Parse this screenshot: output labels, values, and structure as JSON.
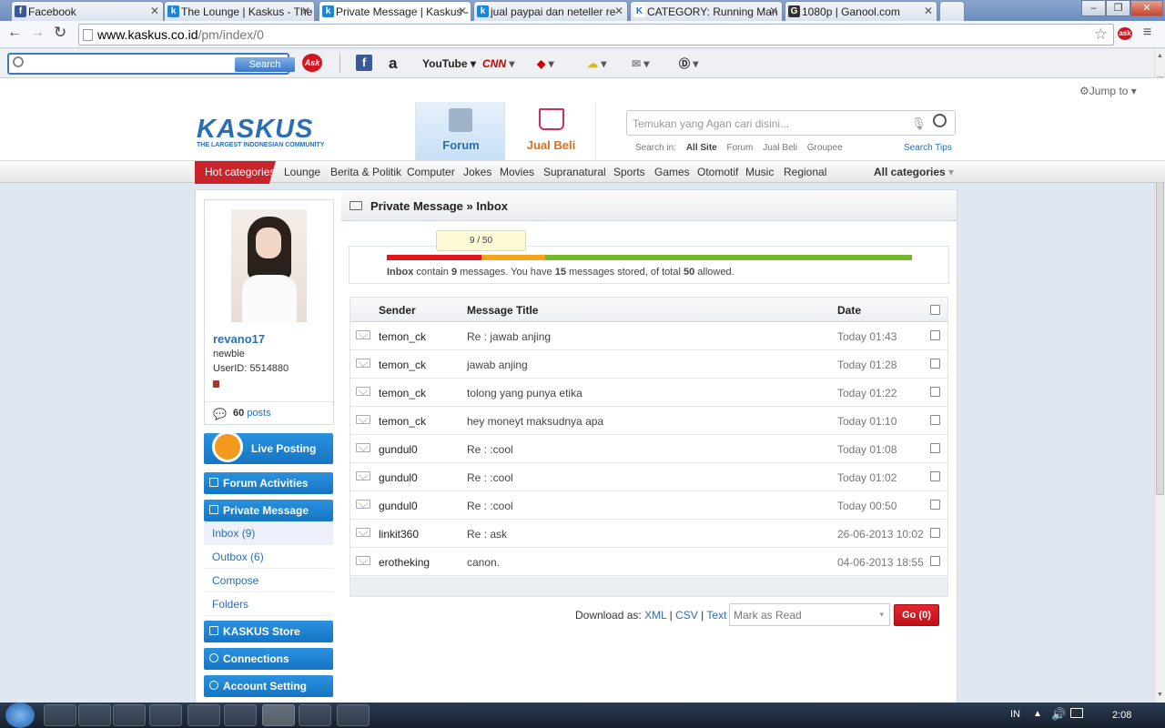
{
  "browser": {
    "tabs": [
      {
        "title": "Facebook",
        "icon": "f"
      },
      {
        "title": "The Lounge | Kaskus - The",
        "icon": "k"
      },
      {
        "title": "Private Message | Kaskus -",
        "icon": "k"
      },
      {
        "title": "jual paypai dan neteller re",
        "icon": "k"
      },
      {
        "title": "CATEGORY: Running Man",
        "icon": "K"
      },
      {
        "title": "1080p | Ganool.com",
        "icon": "G"
      }
    ],
    "url_host": "www.kaskus.co.id",
    "url_path": "/pm/index/0"
  },
  "ask_toolbar": {
    "search_button": "Search",
    "search_value": "",
    "ask_label": "Ask",
    "youtube_label": "YouTube",
    "cnn_label": "CNN"
  },
  "site": {
    "logo_text": "KASKUS",
    "logo_tagline": "THE LARGEST INDONESIAN COMMUNITY",
    "jump_to": "Jump to",
    "forum_label": "Forum",
    "jualbeli_label": "Jual Beli",
    "search_placeholder": "Temukan yang Agan cari disini...",
    "search_in_label": "Search in:",
    "search_scopes": [
      "All Site",
      "Forum",
      "Jual Beli",
      "Groupee"
    ],
    "search_tips": "Search Tips"
  },
  "categories": {
    "hot": "Hot categories",
    "items": [
      "Lounge",
      "Berita & Politik",
      "Computer",
      "Jokes",
      "Movies",
      "Supranatural",
      "Sports",
      "Games",
      "Otomotif",
      "Music",
      "Regional"
    ],
    "all": "All categories"
  },
  "profile": {
    "username": "revano17",
    "rank": "newbie",
    "userid": "UserID: 5514880",
    "posts_count": "60",
    "posts_label": "posts"
  },
  "sidebar": {
    "live_posting": "Live Posting",
    "forum_activities": "Forum Activities",
    "private_message": "Private Message",
    "inbox": "Inbox (9)",
    "outbox": "Outbox (6)",
    "compose": "Compose",
    "folders": "Folders",
    "store": "KASKUS Store",
    "connections": "Connections",
    "account_setting": "Account Setting"
  },
  "pm": {
    "title": "Private Message » Inbox",
    "quota_badge": "9 / 50",
    "quota_fraction": 0.18,
    "quota_parts": {
      "inbox": "Inbox",
      "t1": " contain ",
      "count": "9",
      "t2": " messages. You have ",
      "stored": "15",
      "t3": " messages stored, of total ",
      "total": "50",
      "t4": " allowed."
    },
    "columns": {
      "sender": "Sender",
      "title": "Message Title",
      "date": "Date"
    },
    "messages": [
      {
        "sender": "temon_ck",
        "title": "Re : jawab anjing",
        "date": "Today 01:43"
      },
      {
        "sender": "temon_ck",
        "title": "jawab anjing",
        "date": "Today 01:28"
      },
      {
        "sender": "temon_ck",
        "title": "tolong yang punya etika",
        "date": "Today 01:22"
      },
      {
        "sender": "temon_ck",
        "title": "hey moneyt maksudnya apa",
        "date": "Today 01:10"
      },
      {
        "sender": "gundul0",
        "title": "Re : :cool",
        "date": "Today 01:08"
      },
      {
        "sender": "gundul0",
        "title": "Re : :cool",
        "date": "Today 01:02"
      },
      {
        "sender": "gundul0",
        "title": "Re : :cool",
        "date": "Today 00:50"
      },
      {
        "sender": "linkit360",
        "title": "Re : ask",
        "date": "26-06-2013 10:02"
      },
      {
        "sender": "erotheking",
        "title": "canon.",
        "date": "04-06-2013 18:55"
      }
    ],
    "download_label": "Download as:",
    "download_xml": "XML",
    "download_csv": "CSV",
    "download_text": "Text",
    "sep": "|",
    "action_select": "Mark as Read",
    "go_button": "Go (0)"
  },
  "taskbar": {
    "lang": "IN",
    "clock": "2:08"
  },
  "colors": {
    "kaskus_blue": "#1e84d4",
    "hot_red": "#c9232b",
    "go_red": "#d0161e",
    "bar_red": "#e0161b",
    "bar_orange": "#f5a31a",
    "bar_green": "#77b72b"
  }
}
